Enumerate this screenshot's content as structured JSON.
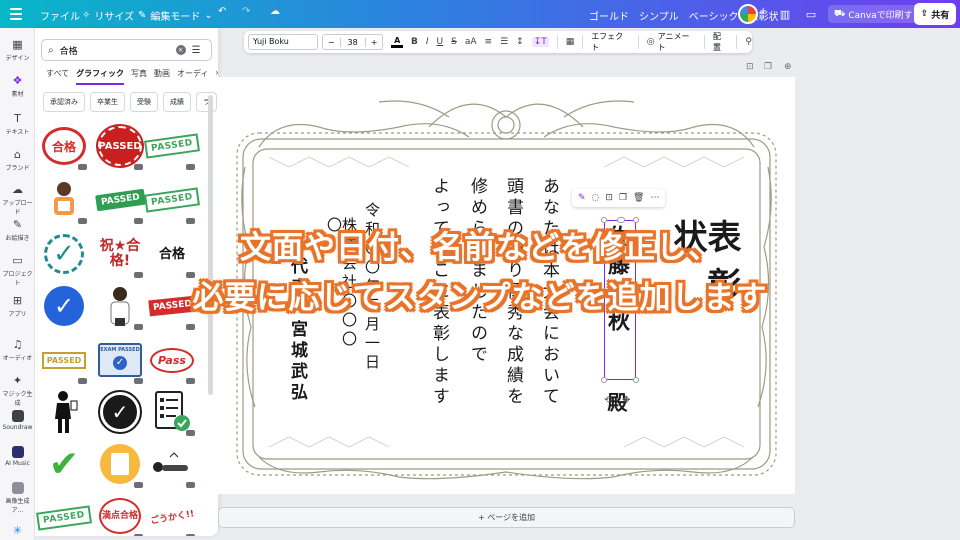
{
  "topbar": {
    "file": "ファイル",
    "resize": "リサイズ",
    "edit_mode": "編集モード",
    "doc_title": "ゴールド　シンプル　ベーシック　表彰状",
    "print": "Canvaで印刷する",
    "share": "共有"
  },
  "rail": {
    "items": [
      {
        "label": "デザイン",
        "icon": "design-icon"
      },
      {
        "label": "素材",
        "icon": "elements-icon"
      },
      {
        "label": "テキスト",
        "icon": "text-icon"
      },
      {
        "label": "ブランド",
        "icon": "brand-icon"
      },
      {
        "label": "アップロード",
        "icon": "upload-icon"
      },
      {
        "label": "お絵描き",
        "icon": "draw-icon"
      },
      {
        "label": "プロジェクト",
        "icon": "projects-icon"
      },
      {
        "label": "アプリ",
        "icon": "apps-icon"
      },
      {
        "label": "オーディオ",
        "icon": "audio-icon"
      },
      {
        "label": "マジック生成",
        "icon": "magic-icon"
      },
      {
        "label": "Soundraw",
        "icon": "soundraw-icon"
      },
      {
        "label": "AI Music",
        "icon": "ai-music-icon"
      },
      {
        "label": "画像生成ア...",
        "icon": "image-gen-icon"
      }
    ]
  },
  "panel": {
    "search_value": "合格",
    "tabs": [
      "すべて",
      "グラフィック",
      "写真",
      "動画",
      "オーディ"
    ],
    "active_tab": "グラフィック",
    "chips": [
      "承認済み",
      "卒業生",
      "受験",
      "成績",
      "ラ"
    ],
    "graphics": {
      "r1a": "合格",
      "r1b": "PASSED",
      "r1c": "PASSED",
      "r2b": "PASSED",
      "r2c": "PASSED",
      "r3b": "祝★合格!",
      "r3c": "合格",
      "r4c": "PASSED",
      "r5a": "PASSED",
      "r5b": "EXAM PASSED",
      "r5c": "Pass",
      "r7a": "PASSED",
      "r7b": "満点合格",
      "r7c": "ごうかく!!"
    }
  },
  "toolbar": {
    "font": "Yuji Boku",
    "size": "38",
    "effect": "エフェクト",
    "animate": "アニメート",
    "position": "配置"
  },
  "certificate": {
    "title_a": "表",
    "title_b": "彰",
    "title_c": "状",
    "recipient": "佐藤千秋",
    "honorific": "殿",
    "body_1": "あなたは本大会において",
    "body_2": "頭書の通り優秀な成績を",
    "body_3": "修められましたので",
    "body_4": "よってここに表彰します",
    "date": "令和〇〇年三月一日",
    "org": "株式会社〇〇〇〇",
    "signer": "代表　宮城武弘"
  },
  "add_page": "+ ページを追加",
  "overlay": {
    "line1": "文面や日付、名前などを修正し、",
    "line2": "必要に応じてスタンプなどを追加します"
  },
  "colors": {
    "accent": "#7d2ae8",
    "overlay_stroke": "#e8742a",
    "topbar_start": "#08b6c8",
    "topbar_end": "#6e3df0"
  }
}
